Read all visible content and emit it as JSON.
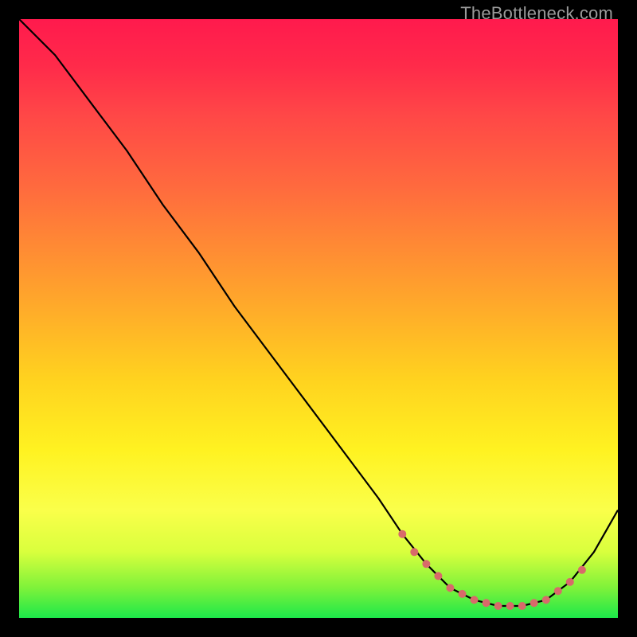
{
  "watermark": "TheBottleneck.com",
  "colors": {
    "background": "#000000",
    "line": "#000000",
    "dot": "#d86a6a"
  },
  "chart_data": {
    "type": "line",
    "title": "",
    "xlabel": "",
    "ylabel": "",
    "xlim": [
      0,
      100
    ],
    "ylim": [
      0,
      100
    ],
    "grid": false,
    "series": [
      {
        "name": "bottleneck-curve",
        "x": [
          0,
          6,
          12,
          18,
          24,
          30,
          36,
          42,
          48,
          54,
          60,
          64,
          68,
          72,
          76,
          80,
          84,
          88,
          92,
          96,
          100
        ],
        "y": [
          100,
          94,
          86,
          78,
          69,
          61,
          52,
          44,
          36,
          28,
          20,
          14,
          9,
          5,
          3,
          2,
          2,
          3,
          6,
          11,
          18
        ]
      }
    ],
    "highlight_dots": {
      "name": "valley-dots",
      "x": [
        64,
        66,
        68,
        70,
        72,
        74,
        76,
        78,
        80,
        82,
        84,
        86,
        88,
        90,
        92,
        94
      ],
      "y": [
        14,
        11,
        9,
        7,
        5,
        4,
        3,
        2.5,
        2,
        2,
        2,
        2.5,
        3,
        4.5,
        6,
        8
      ]
    }
  }
}
